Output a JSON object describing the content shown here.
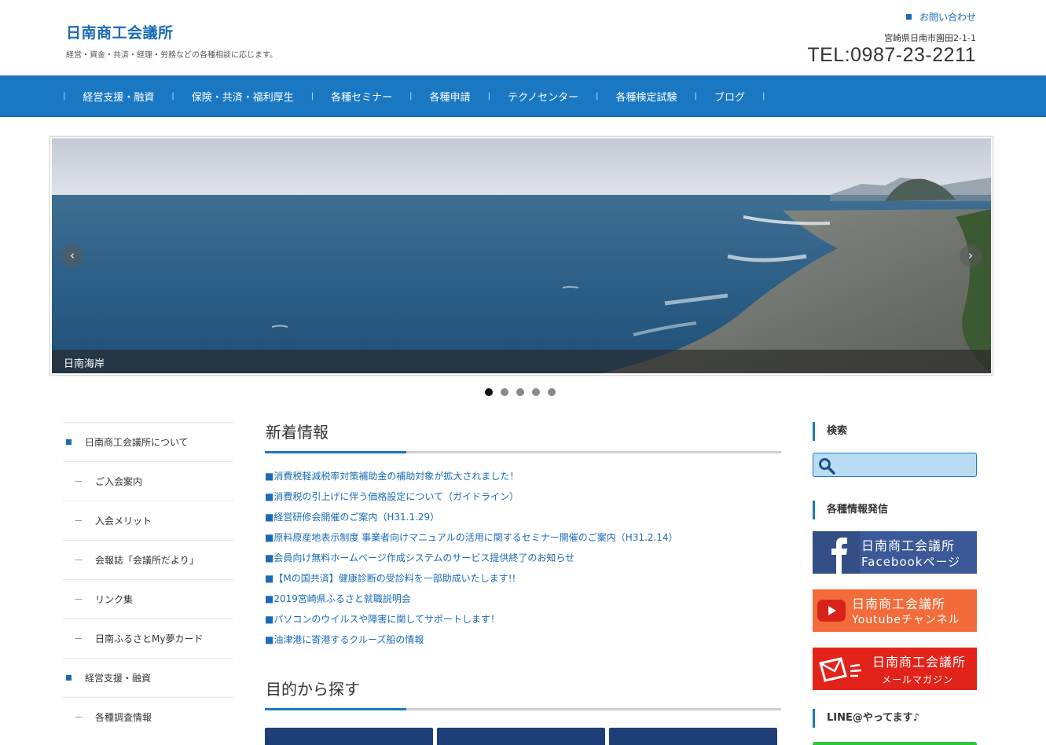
{
  "header": {
    "site_title": "日南商工会議所",
    "site_description": "経営・資金・共済・経理・労務などの各種相談に応じます。",
    "contact_link": "お問い合わせ",
    "address": "宮崎県日南市園田2-1-1",
    "tel": "TEL:0987-23-2211"
  },
  "nav": {
    "items": [
      "経営支援・融資",
      "保険・共済・福利厚生",
      "各種セミナー",
      "各種申請",
      "テクノセンター",
      "各種検定試験",
      "ブログ"
    ]
  },
  "slider": {
    "caption": "日南海岸",
    "prev": "‹",
    "next": "›",
    "slide_count": 5,
    "active_index": 0
  },
  "sidebar": {
    "items": [
      {
        "label": "日南商工会議所について",
        "level": 1
      },
      {
        "label": "ご入会案内",
        "level": 2
      },
      {
        "label": "入会メリット",
        "level": 2
      },
      {
        "label": "会報誌「会議所だより」",
        "level": 2
      },
      {
        "label": "リンク集",
        "level": 2
      },
      {
        "label": "日南ふるさとMy夢カード",
        "level": 2
      },
      {
        "label": "経営支援・融資",
        "level": 1
      },
      {
        "label": "各種調査情報",
        "level": 2
      }
    ]
  },
  "main": {
    "news_title": "新着情報",
    "news": [
      "■消費税軽減税率対策補助金の補助対象が拡大されました！",
      "■消費税の引上げに伴う価格設定について（ガイドライン）",
      "■経営研修会開催のご案内（H31.1.29）",
      "■原料原産地表示制度 事業者向けマニュアルの活用に関するセミナー開催のご案内（H31.2.14）",
      "■会員向け無料ホームページ作成システムのサービス提供終了のお知らせ",
      "■【Mの国共済】健康診断の受診料を一部助成いたします!!",
      "■2019宮崎県ふるさと就職説明会",
      "■パソコンのウイルスや障害に関してサポートします！",
      "■油津港に寄港するクルーズ船の情報"
    ],
    "purpose_title": "目的から探す"
  },
  "right": {
    "search_title": "検索",
    "search_placeholder": "",
    "info_title": "各種情報発信",
    "facebook": {
      "line1": "日南商工会議所",
      "line2": "Facebookページ"
    },
    "youtube": {
      "line1": "日南商工会議所",
      "line2": "Youtubeチャンネル"
    },
    "mail": {
      "line1": "日南商工会議所",
      "line2": "メールマガジン"
    },
    "line_title": "LINE@やってます♪"
  },
  "colors": {
    "brand_blue": "#1a78c2",
    "title_blue": "#1a6bb5",
    "facebook": "#3b5998",
    "youtube": "#f36b3a",
    "mail": "#e2231a",
    "line": "#2fc43a",
    "purpose_button": "#1f3e77"
  }
}
